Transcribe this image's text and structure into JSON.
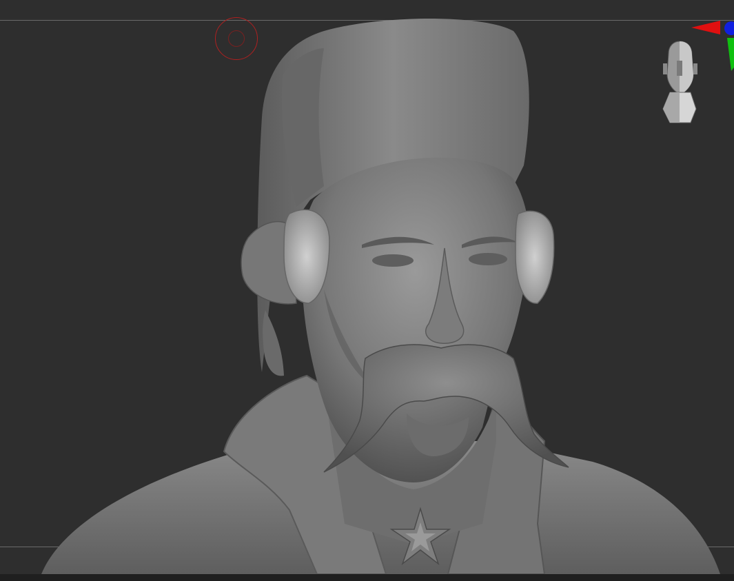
{
  "viewport": {
    "background": "#2e2e2e",
    "model": "sculpted-bust-with-mustache",
    "guide_color": "#6a6a6a"
  },
  "brush": {
    "color": "#b02020"
  },
  "navigator": {
    "icon": "head-navigator-icon"
  },
  "axis_gizmo": {
    "x_color": "#e01010",
    "y_color": "#10c010",
    "z_color": "#1020e0"
  }
}
